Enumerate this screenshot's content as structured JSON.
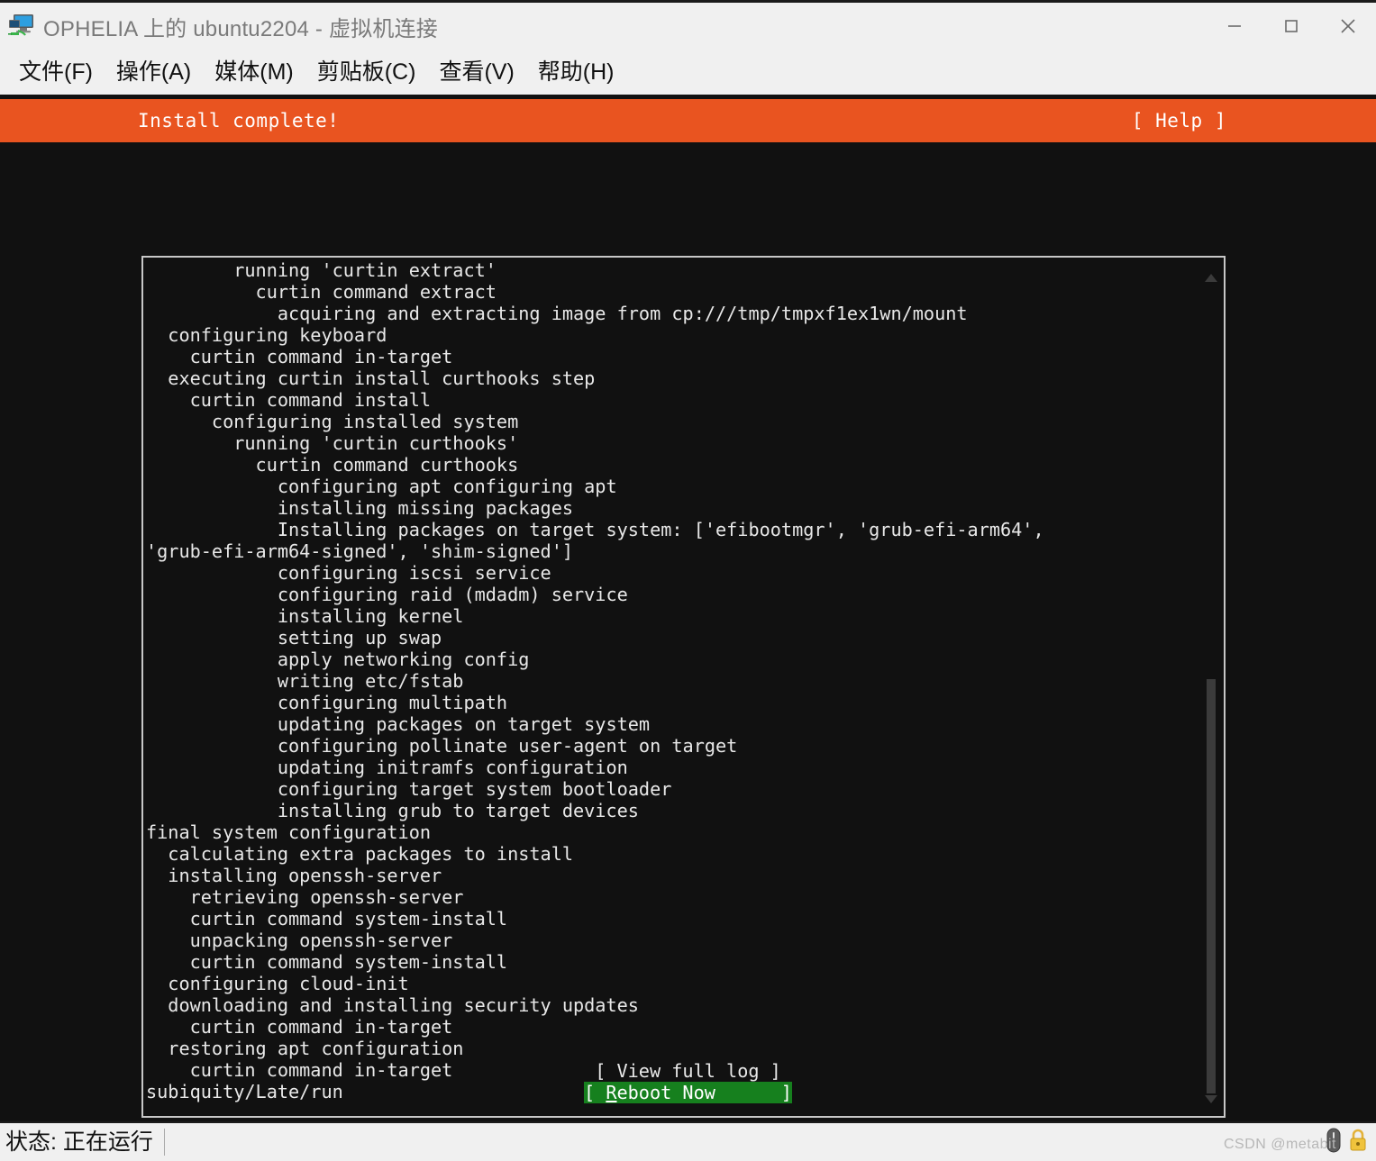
{
  "window": {
    "title": "OPHELIA 上的 ubuntu2204 - 虚拟机连接",
    "icon": "vm-connect-icon",
    "controls": {
      "minimize": "minimize-icon",
      "maximize": "maximize-icon",
      "close": "close-icon"
    }
  },
  "menubar": {
    "items": [
      {
        "label": "文件(F)"
      },
      {
        "label": "操作(A)"
      },
      {
        "label": "媒体(M)"
      },
      {
        "label": "剪贴板(C)"
      },
      {
        "label": "查看(V)"
      },
      {
        "label": "帮助(H)"
      }
    ]
  },
  "installer": {
    "header": {
      "title": "Install complete!",
      "help": "[ Help ]",
      "background_color": "#e95420",
      "text_color": "#ffffff"
    },
    "log": "        running 'curtin extract'\n          curtin command extract\n            acquiring and extracting image from cp:///tmp/tmpxf1ex1wn/mount\n  configuring keyboard\n    curtin command in-target\n  executing curtin install curthooks step\n    curtin command install\n      configuring installed system\n        running 'curtin curthooks'\n          curtin command curthooks\n            configuring apt configuring apt\n            installing missing packages\n            Installing packages on target system: ['efibootmgr', 'grub-efi-arm64',\n'grub-efi-arm64-signed', 'shim-signed']\n            configuring iscsi service\n            configuring raid (mdadm) service\n            installing kernel\n            setting up swap\n            apply networking config\n            writing etc/fstab\n            configuring multipath\n            updating packages on target system\n            configuring pollinate user-agent on target\n            updating initramfs configuration\n            configuring target system bootloader\n            installing grub to target devices\nfinal system configuration\n  calculating extra packages to install\n  installing openssh-server\n    retrieving openssh-server\n    curtin command system-install\n    unpacking openssh-server\n    curtin command system-install\n  configuring cloud-init\n  downloading and installing security updates\n    curtin command in-target\n  restoring apt configuration\n    curtin command in-target\nsubiquity/Late/run",
    "scrollbar": {
      "up_arrow": "scroll-up-arrow-icon",
      "down_arrow": "scroll-down-arrow-icon"
    },
    "buttons": {
      "view_full_log": "[ View full log ]",
      "reboot_prefix": "[ ",
      "reboot_accel": "R",
      "reboot_rest": "eboot Now      ]",
      "selected_color": "#16801e"
    }
  },
  "statusbar": {
    "status": "状态: 正在运行",
    "watermark": "CSDN @metabit",
    "icons": [
      "mouse-icon",
      "lock-icon"
    ]
  }
}
